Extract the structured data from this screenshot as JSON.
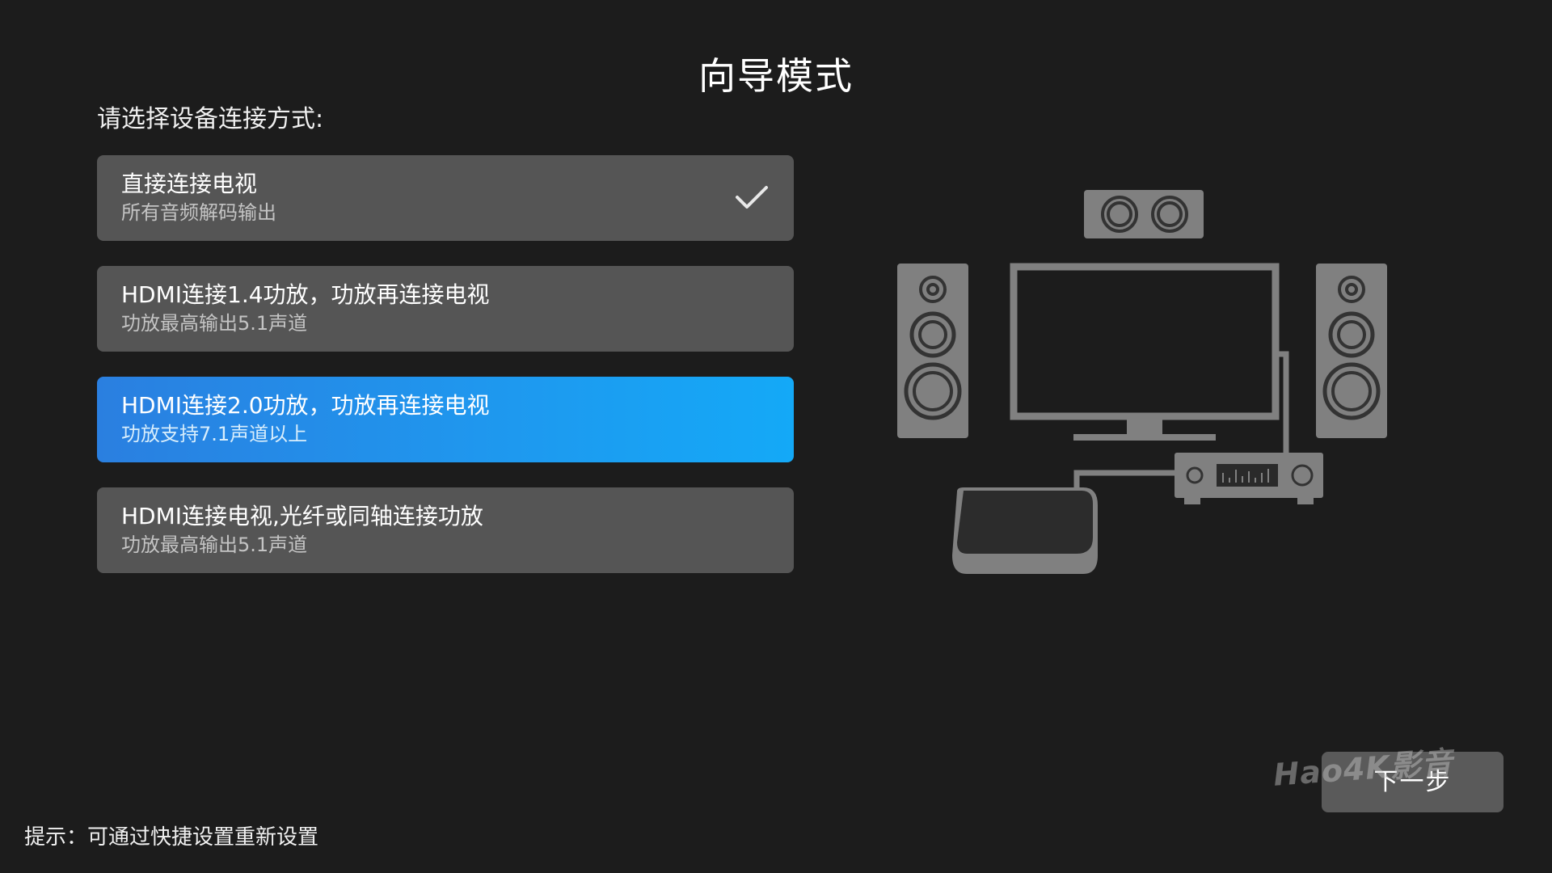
{
  "title": "向导模式",
  "prompt": "请选择设备连接方式:",
  "options": [
    {
      "title": "直接连接电视",
      "subtitle": "所有音频解码输出",
      "selected": true
    },
    {
      "title": "HDMI连接1.4功放，功放再连接电视",
      "subtitle": "功放最高输出5.1声道",
      "selected": false
    },
    {
      "title": "HDMI连接2.0功放，功放再连接电视",
      "subtitle": "功放支持7.1声道以上",
      "selected": false
    },
    {
      "title": "HDMI连接电视,光纤或同轴连接功放",
      "subtitle": "功放最高输出5.1声道",
      "selected": false
    }
  ],
  "focused_index": 2,
  "next_label": "下一步",
  "watermark": "Hao4K影音",
  "hint": "提示：可通过快捷设置重新设置",
  "colors": {
    "background": "#1c1c1c",
    "option_bg": "#555555",
    "focus_start": "#2a7fe0",
    "focus_end": "#14a9f7",
    "illustration": "#808080"
  },
  "icons": {
    "selected_marker": "check-icon",
    "illustration": "home-theater-illustration"
  }
}
